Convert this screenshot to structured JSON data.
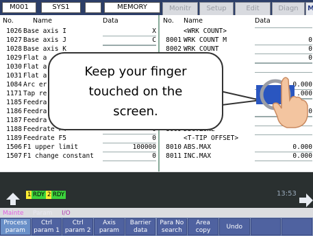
{
  "topbar": {
    "program": "M001",
    "system": "SYS1",
    "blank": "",
    "mode": "MEMORY",
    "tabs": [
      "Monitr",
      "Setup",
      "Edit",
      "Diagn",
      "Mainte"
    ]
  },
  "table": {
    "left_header": {
      "no": "No.",
      "name": "Name",
      "data": "Data"
    },
    "right_header": {
      "no": "No.",
      "name": "Name",
      "data": "Data"
    },
    "left_rows": [
      {
        "no": "1026",
        "name": "Base axis I",
        "value": "X"
      },
      {
        "no": "1027",
        "name": "Base axis J",
        "value": "C"
      },
      {
        "no": "1028",
        "name": "Base axis K",
        "value": ""
      },
      {
        "no": "1029",
        "name": "Flat a",
        "value": ""
      },
      {
        "no": "1030",
        "name": "Flat a",
        "value": ""
      },
      {
        "no": "1031",
        "name": "Flat a",
        "value": ""
      },
      {
        "no": "1084",
        "name": "Arc er",
        "value": ""
      },
      {
        "no": "1171",
        "name": "Tap re",
        "value": ""
      },
      {
        "no": "1185",
        "name": "Feedra",
        "value": ""
      },
      {
        "no": "1186",
        "name": "Feedra",
        "value": ""
      },
      {
        "no": "1187",
        "name": "Feedra",
        "value": ""
      },
      {
        "no": "1188",
        "name": "Feedrate F4",
        "value": "0"
      },
      {
        "no": "1189",
        "name": "Feedrate F5",
        "value": "0"
      },
      {
        "no": "1506",
        "name": "F1 upper limit",
        "value": "100000"
      },
      {
        "no": "1507",
        "name": "F1 change constant",
        "value": "0"
      }
    ],
    "right_rows": [
      {
        "no": "",
        "name": "<WRK COUNT>",
        "value": ""
      },
      {
        "no": "8001",
        "name": "WRK COUNT M",
        "value": "0"
      },
      {
        "no": "8002",
        "name": "WRK COUNT",
        "value": "0"
      },
      {
        "no": "",
        "name": "IMIT",
        "value": "0"
      },
      {
        "no": "",
        "name": "",
        "value": ""
      },
      {
        "no": "",
        "name": "",
        "value": ""
      },
      {
        "no": "",
        "name": "",
        "value": "0.000"
      },
      {
        "no": "",
        "name": "",
        "value": ".000"
      },
      {
        "no": "",
        "name": "OVR.>",
        "value": ""
      },
      {
        "no": "",
        "name": "",
        "value": "0"
      },
      {
        "no": "",
        "name": "",
        "value": ""
      },
      {
        "no": "8009",
        "name": "DSC.ZONE",
        "value": ""
      },
      {
        "no": "",
        "name": "<T-TIP OFFSET>",
        "value": ""
      },
      {
        "no": "8010",
        "name": "ABS.MAX",
        "value": "0.000"
      },
      {
        "no": "8011",
        "name": "INC.MAX",
        "value": "0.000"
      }
    ]
  },
  "popup": {
    "line1": "Keep your finger",
    "line2": "touched on the",
    "line3": "screen."
  },
  "status": {
    "rdy1_num": "1",
    "rdy1": "RDY",
    "rdy2_num": "2",
    "rdy2": "RDY",
    "clock": "13:53",
    "bread_mode": "Mainte",
    "bread_param": "Param",
    "bread_io": "I/O"
  },
  "softkeys": [
    {
      "l1": "Process",
      "l2": "param"
    },
    {
      "l1": "Ctrl",
      "l2": "param 1"
    },
    {
      "l1": "Ctrl",
      "l2": "param 2"
    },
    {
      "l1": "Axis",
      "l2": "param"
    },
    {
      "l1": "Barrier",
      "l2": "data"
    },
    {
      "l1": "Para No",
      "l2": "search"
    },
    {
      "l1": "Area",
      "l2": "copy"
    },
    {
      "l1": "Undo",
      "l2": ""
    },
    {
      "l1": "",
      "l2": ""
    },
    {
      "l1": "",
      "l2": ""
    }
  ],
  "colors": {
    "topbar": "#2c3e68",
    "active_tab": "#2a3f86",
    "statusbar": "#2a3030",
    "softkey": "#4f62a0",
    "rdy_green": "#3cd23c",
    "rdy_yellow": "#ffee33"
  },
  "icons": [
    "home-arrow-icon",
    "next-page-arrow-icon",
    "pointing-hand-icon"
  ]
}
